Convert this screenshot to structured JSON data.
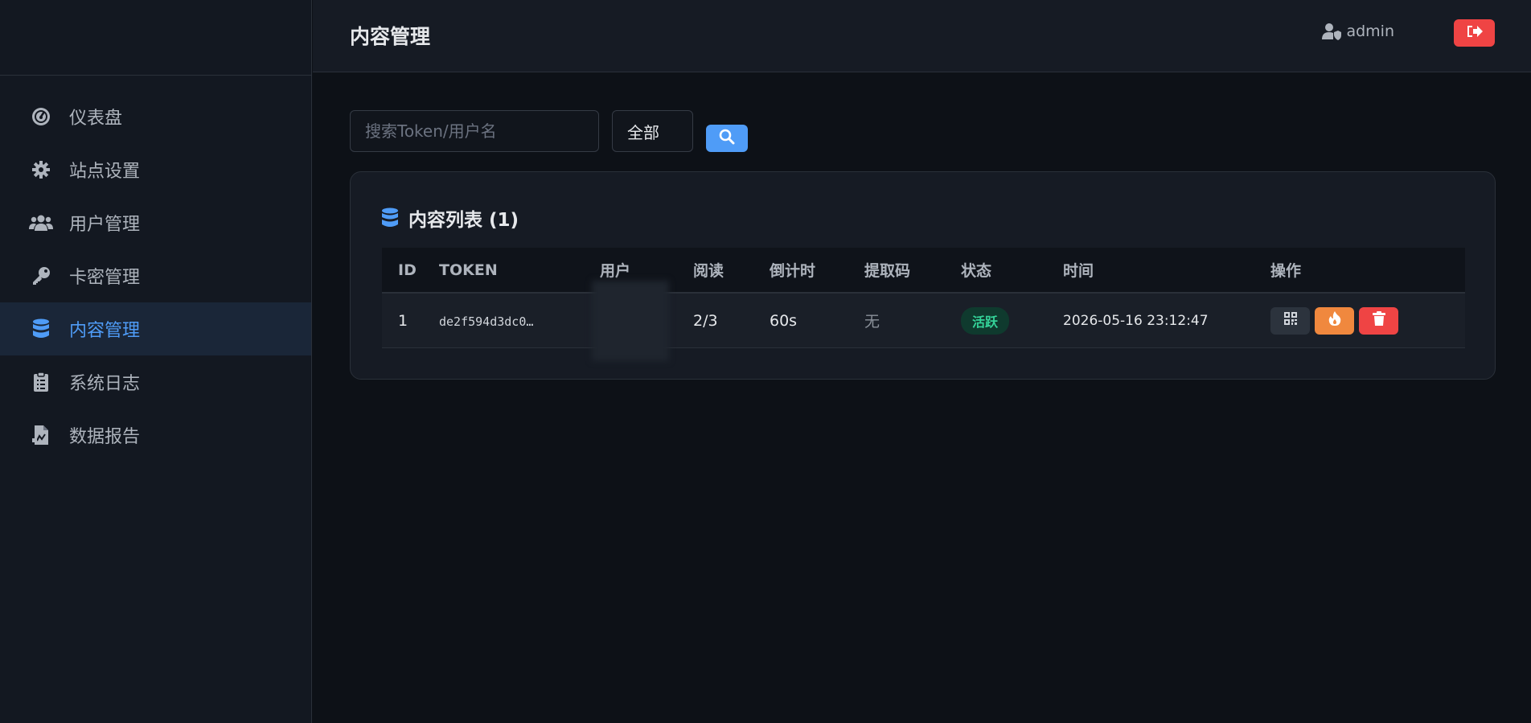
{
  "sidebar": {
    "items": [
      {
        "label": "仪表盘",
        "icon": "dashboard-icon"
      },
      {
        "label": "站点设置",
        "icon": "gear-icon"
      },
      {
        "label": "用户管理",
        "icon": "users-icon"
      },
      {
        "label": "卡密管理",
        "icon": "key-icon"
      },
      {
        "label": "内容管理",
        "icon": "database-icon",
        "active": true
      },
      {
        "label": "系统日志",
        "icon": "clipboard-icon"
      },
      {
        "label": "数据报告",
        "icon": "report-icon"
      }
    ]
  },
  "header": {
    "title": "内容管理",
    "username": "admin",
    "logout_icon": "sign-out-icon"
  },
  "filters": {
    "search_placeholder": "搜索Token/用户名",
    "search_value": "",
    "status_selected": "全部",
    "search_button_icon": "search-icon"
  },
  "content_list": {
    "title": "内容列表 (1)",
    "columns": [
      "ID",
      "TOKEN",
      "用户",
      "阅读",
      "倒计时",
      "提取码",
      "状态",
      "时间",
      "操作"
    ],
    "rows": [
      {
        "id": "1",
        "token": "de2f594d3dc0…",
        "user": "",
        "read": "2/3",
        "countdown": "60s",
        "code": "无",
        "status": "活跃",
        "time": "2026-05-16 23:12:47"
      }
    ]
  },
  "colors": {
    "accent": "#4f9cf7",
    "danger": "#ef4444",
    "warning": "#f0883e",
    "success": "#34d399"
  }
}
